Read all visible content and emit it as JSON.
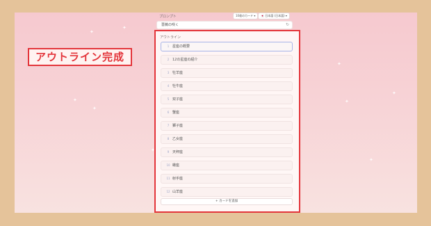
{
  "callout": {
    "text": "アウトライン完成"
  },
  "prompt": {
    "label": "プロンプト",
    "input_value": "薔薇の咲く",
    "selects": [
      "10枚のカード ▾",
      "🇯🇵 日本語 (日本語) ▾"
    ]
  },
  "outline": {
    "title": "アウトライン",
    "items": [
      {
        "num": "1",
        "label": "星座の概要"
      },
      {
        "num": "2",
        "label": "12の星座の紹介"
      },
      {
        "num": "3",
        "label": "牡羊座"
      },
      {
        "num": "4",
        "label": "牡牛座"
      },
      {
        "num": "5",
        "label": "双子座"
      },
      {
        "num": "6",
        "label": "蟹座"
      },
      {
        "num": "7",
        "label": "獅子座"
      },
      {
        "num": "8",
        "label": "乙女座"
      },
      {
        "num": "9",
        "label": "天秤座"
      },
      {
        "num": "10",
        "label": "蠍座"
      },
      {
        "num": "11",
        "label": "射手座"
      },
      {
        "num": "12",
        "label": "山羊座"
      }
    ],
    "add_button": "+ カードを追加"
  },
  "colors": {
    "callout_red": "#e3343a",
    "bg": "#e5c39a"
  }
}
